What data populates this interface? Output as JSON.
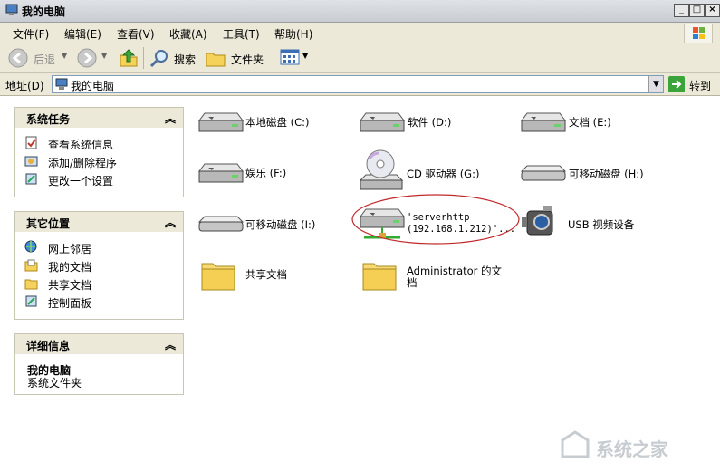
{
  "window": {
    "title": "我的电脑",
    "min": "_",
    "max": "□",
    "close": "×"
  },
  "menu": [
    "文件(F)",
    "编辑(E)",
    "查看(V)",
    "收藏(A)",
    "工具(T)",
    "帮助(H)"
  ],
  "toolbar": {
    "back": "后退",
    "search": "搜索",
    "folders": "文件夹"
  },
  "address": {
    "label": "地址(D)",
    "value": "我的电脑",
    "go": "转到"
  },
  "panels": {
    "tasks": {
      "title": "系统任务",
      "items": [
        "查看系统信息",
        "添加/删除程序",
        "更改一个设置"
      ]
    },
    "places": {
      "title": "其它位置",
      "items": [
        "网上邻居",
        "我的文档",
        "共享文档",
        "控制面板"
      ]
    },
    "details": {
      "title": "详细信息",
      "name": "我的电脑",
      "desc": "系统文件夹"
    }
  },
  "items": [
    {
      "label": "本地磁盘 (C:)",
      "icon": "hard-drive-icon"
    },
    {
      "label": "软件 (D:)",
      "icon": "hard-drive-icon"
    },
    {
      "label": "文档 (E:)",
      "icon": "hard-drive-icon"
    },
    {
      "label": "娱乐 (F:)",
      "icon": "hard-drive-icon"
    },
    {
      "label": "CD 驱动器 (G:)",
      "icon": "cd-drive-icon"
    },
    {
      "label": "可移动磁盘 (H:)",
      "icon": "removable-drive-icon"
    },
    {
      "label": "可移动磁盘 (I:)",
      "icon": "removable-drive-icon"
    },
    {
      "label_line1": "'serverhttp",
      "label_line2": "(192.168.1.212)'...",
      "icon": "network-drive-icon"
    },
    {
      "label": "USB 视频设备",
      "icon": "camera-icon"
    },
    {
      "label": "共享文档",
      "icon": "folder-icon"
    },
    {
      "label_line1": "Administrator 的文",
      "label_line2": "档",
      "icon": "folder-icon"
    }
  ],
  "watermark": "系统之家"
}
